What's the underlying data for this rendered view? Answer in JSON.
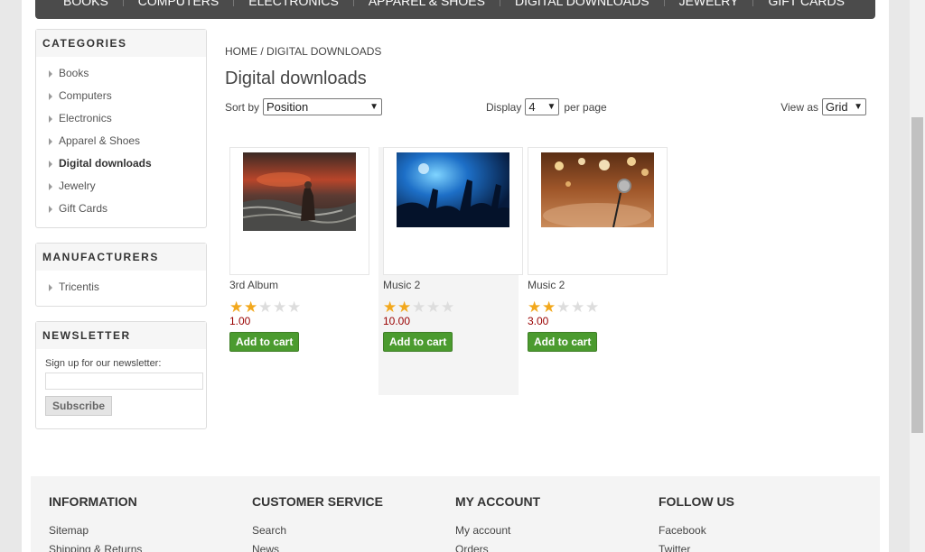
{
  "topnav": [
    "BOOKS",
    "COMPUTERS",
    "ELECTRONICS",
    "APPAREL & SHOES",
    "DIGITAL DOWNLOADS",
    "JEWELRY",
    "GIFT CARDS"
  ],
  "categories": {
    "title": "CATEGORIES",
    "items": [
      "Books",
      "Computers",
      "Electronics",
      "Apparel & Shoes",
      "Digital downloads",
      "Jewelry",
      "Gift Cards"
    ],
    "active": "Digital downloads"
  },
  "manufacturers": {
    "title": "MANUFACTURERS",
    "items": [
      "Tricentis"
    ]
  },
  "newsletter": {
    "title": "NEWSLETTER",
    "label": "Sign up for our newsletter:",
    "button": "Subscribe"
  },
  "breadcrumb": {
    "home": "HOME",
    "sep": "/",
    "current": "DIGITAL DOWNLOADS"
  },
  "page_title": "Digital downloads",
  "toolbar": {
    "sort_label": "Sort by",
    "sort_value": "Position",
    "display_label": "Display",
    "display_value": "4",
    "per_page": "per page",
    "view_label": "View as",
    "view_value": "Grid"
  },
  "products": [
    {
      "title": "3rd Album",
      "rating": 2,
      "price": "1.00",
      "button": "Add to cart"
    },
    {
      "title": "Music 2",
      "rating": 2,
      "price": "10.00",
      "button": "Add to cart"
    },
    {
      "title": "Music 2",
      "rating": 2,
      "price": "3.00",
      "button": "Add to cart"
    }
  ],
  "footer": [
    {
      "title": "INFORMATION",
      "links": [
        "Sitemap",
        "Shipping & Returns"
      ]
    },
    {
      "title": "CUSTOMER SERVICE",
      "links": [
        "Search",
        "News"
      ]
    },
    {
      "title": "MY ACCOUNT",
      "links": [
        "My account",
        "Orders"
      ]
    },
    {
      "title": "FOLLOW US",
      "links": [
        "Facebook",
        "Twitter"
      ]
    }
  ],
  "colors": {
    "nav_bg": "#4b4b4b",
    "cart_green": "#4b9b2f",
    "price_red": "#990000",
    "star": "#f2a81d"
  }
}
